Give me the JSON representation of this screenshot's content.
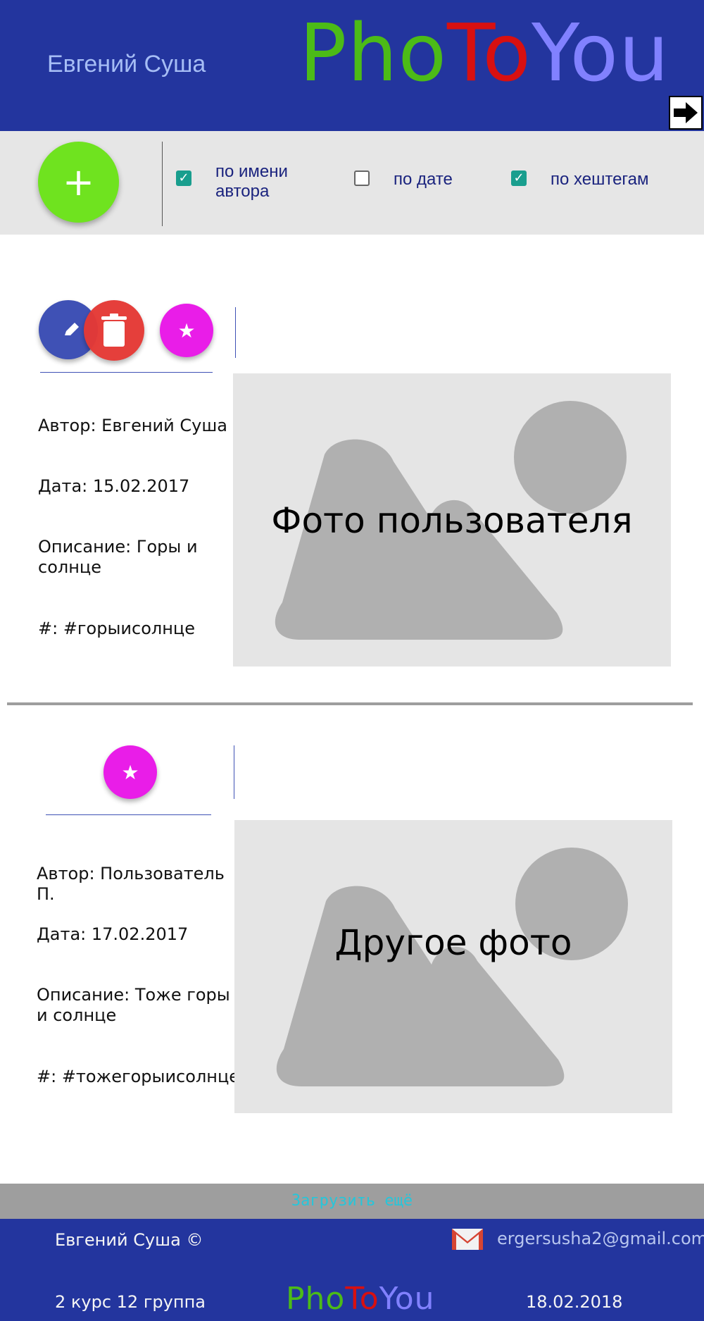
{
  "header": {
    "user_name": "Евгений Суша",
    "logo": {
      "part1": "Pho",
      "part2": "To",
      "part3": "You"
    },
    "logout_icon": "arrow-right-icon"
  },
  "toolbar": {
    "add_icon": "plus-icon",
    "add_symbol": "+",
    "filters": [
      {
        "label": "по имени автора",
        "checked": true
      },
      {
        "label": "по дате",
        "checked": false
      },
      {
        "label": "по хештегам",
        "checked": true
      }
    ]
  },
  "posts": [
    {
      "author": "Автор: Евгений Суша",
      "date": "Дата: 15.02.2017",
      "description": "Описание: Горы и солнце",
      "hashtags": "#: #горыисолнце",
      "photo_caption": "Фото пользователя",
      "actions": [
        "edit-icon",
        "delete-icon",
        "star-icon"
      ]
    },
    {
      "author": "Автор: Пользователь П.",
      "date": "Дата: 17.02.2017",
      "description": "Описание: Тоже горы и солнце",
      "hashtags": "#: #тожегорыисолнце",
      "photo_caption": "Другое фото",
      "actions": [
        "star-icon"
      ]
    }
  ],
  "load_more": {
    "label": "Загрузить ещё"
  },
  "footer": {
    "owner": "Евгений Суша ©",
    "email": "ergersusha2@gmail.com",
    "course": "2 курс 12 группа",
    "date": "18.02.2018",
    "logo": {
      "part1": "Pho",
      "part2": "To",
      "part3": "You"
    }
  },
  "colors": {
    "header_bg": "#23359e",
    "accent_green": "#6fe31f",
    "checkbox_on": "#199e8e",
    "fab_star": "#e91de8",
    "fab_edit": "#3f51b5",
    "fab_delete": "#e53935",
    "load_more_bg": "#9e9e9e",
    "load_more_text": "#26c6da"
  }
}
